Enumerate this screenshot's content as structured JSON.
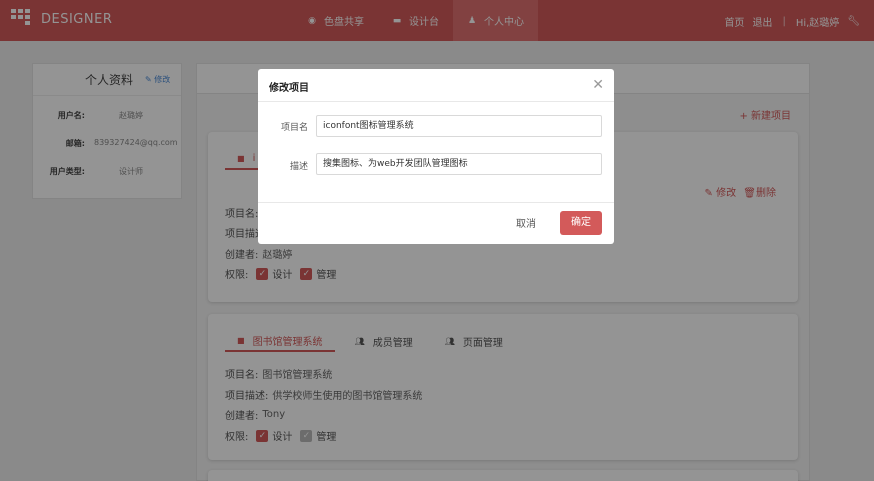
{
  "header": {
    "logo_text": "DESIGNER",
    "nav": [
      {
        "label": "色盘共享",
        "icon": "palette-icon"
      },
      {
        "label": "设计台",
        "icon": "book-icon"
      },
      {
        "label": "个人中心",
        "icon": "user-icon",
        "active": true
      }
    ],
    "right": {
      "home": "首页",
      "logout": "退出",
      "sep": "|",
      "greeting": "Hi,赵璐婷"
    },
    "accent_color": "#d35a5a"
  },
  "profile": {
    "title": "个人资料",
    "edit_label": "修改",
    "rows": [
      {
        "key": "用户名:",
        "value": "赵璐婷"
      },
      {
        "key": "邮箱:",
        "value": "839327424@qq.com"
      },
      {
        "key": "用户类型:",
        "value": "设计师"
      }
    ]
  },
  "main": {
    "new_project_label": "+ 新建项目",
    "cards": [
      {
        "tab_label": "i",
        "actions": {
          "edit": "修改",
          "delete": "删除"
        },
        "fields": {
          "name_label": "项目名:",
          "desc_label": "项目描述:",
          "creator_label": "创建者:",
          "creator_value": "赵璐婷",
          "perm_label": "权限:",
          "perm_design": "设计",
          "perm_manage": "管理"
        }
      },
      {
        "tabs": [
          "图书馆管理系统",
          "成员管理",
          "页面管理"
        ],
        "fields": {
          "name_label": "项目名:",
          "name_value": "图书馆管理系统",
          "desc_label": "项目描述:",
          "desc_value": "供学校师生使用的图书馆管理系统",
          "creator_label": "创建者:",
          "creator_value": "Tony",
          "perm_label": "权限:",
          "perm_design": "设计",
          "perm_manage": "管理"
        }
      }
    ]
  },
  "modal": {
    "title": "修改项目",
    "name_label": "项目名",
    "name_value": "iconfont图标管理系统",
    "desc_label": "描述",
    "desc_value": "搜集图标、为web开发团队管理图标",
    "cancel_label": "取消",
    "ok_label": "确定"
  }
}
